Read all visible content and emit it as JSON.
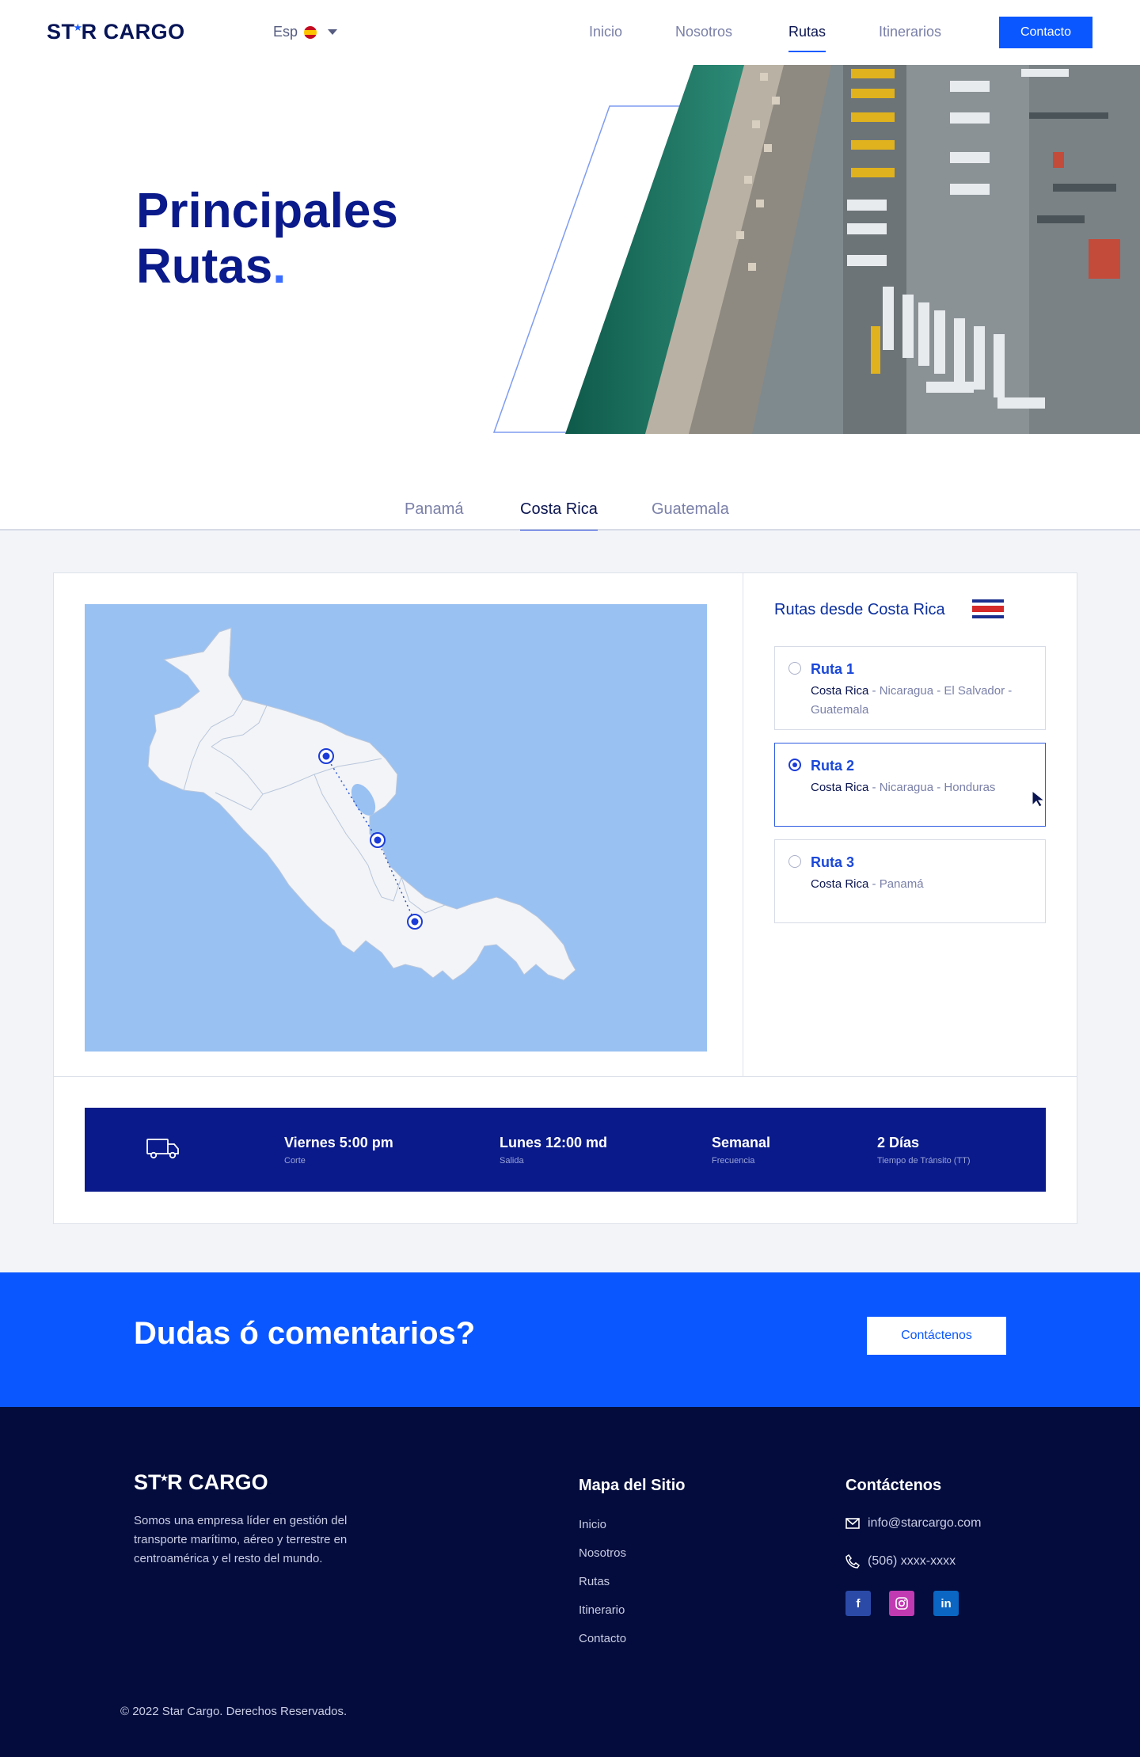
{
  "nav": {
    "logo": "STAR CARGO",
    "language": "Esp",
    "items": [
      {
        "label": "Inicio",
        "active": false
      },
      {
        "label": "Nosotros",
        "active": false
      },
      {
        "label": "Rutas",
        "active": true
      },
      {
        "label": "Itinerarios",
        "active": false
      }
    ],
    "contact_button": "Contacto"
  },
  "hero": {
    "title_line1": "Principales",
    "title_line2": "Rutas",
    "title_dot": "."
  },
  "tabs": [
    {
      "label": "Panamá",
      "active": false
    },
    {
      "label": "Costa Rica",
      "active": true
    },
    {
      "label": "Guatemala",
      "active": false
    }
  ],
  "routes_panel": {
    "title": "Rutas desde Costa Rica",
    "routes": [
      {
        "name": "Ruta 1",
        "origin": "Costa Rica",
        "rest": " - Nicaragua - El Salvador - Guatemala",
        "selected": false
      },
      {
        "name": "Ruta 2",
        "origin": "Costa Rica",
        "rest": " - Nicaragua - Honduras",
        "selected": true
      },
      {
        "name": "Ruta 3",
        "origin": "Costa Rica",
        "rest": " - Panamá",
        "selected": false
      }
    ]
  },
  "schedule": {
    "corte_value": "Viernes 5:00 pm",
    "corte_label": "Corte",
    "salida_value": "Lunes 12:00 md",
    "salida_label": "Salida",
    "frecuencia_value": "Semanal",
    "frecuencia_label": "Frecuencia",
    "transito_value": "2 Días",
    "transito_label": "Tiempo de Tránsito (TT)"
  },
  "cta": {
    "title": "Dudas ó comentarios?",
    "button": "Contáctenos"
  },
  "footer": {
    "logo": "STAR CARGO",
    "description": "Somos una empresa líder en gestión del transporte marítimo, aéreo y terrestre en centroamérica y el resto del mundo.",
    "sitemap_title": "Mapa del Sitio",
    "sitemap_links": [
      "Inicio",
      "Nosotros",
      "Rutas",
      "Itinerario",
      "Contacto"
    ],
    "contact_title": "Contáctenos",
    "email": "info@starcargo.com",
    "phone": "(506) xxxx-xxxx",
    "copyright": "© 2022 Star Cargo. Derechos Reservados."
  },
  "colors": {
    "primary_blue": "#0b57ff",
    "navy": "#0a1a8a",
    "footer_bg": "#030c3d",
    "map_water": "#99c1f2"
  }
}
